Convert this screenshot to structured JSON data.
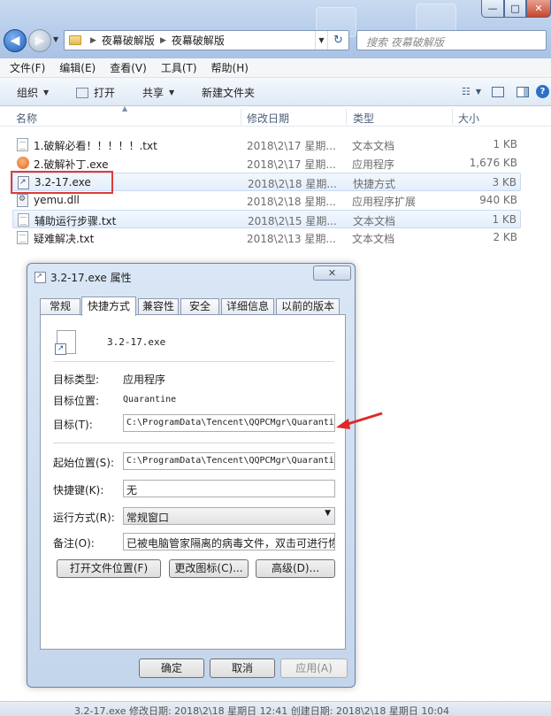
{
  "window": {
    "controls": {
      "minimize": "—",
      "maximize": "□",
      "close": "✕"
    }
  },
  "nav": {
    "back_icon": "back-arrow",
    "forward_icon": "forward-arrow",
    "breadcrumbs": [
      "夜幕破解版",
      "夜幕破解版"
    ],
    "search_placeholder": "搜索 夜幕破解版"
  },
  "menubar": {
    "items": [
      "文件(F)",
      "编辑(E)",
      "查看(V)",
      "工具(T)",
      "帮助(H)"
    ]
  },
  "commandbar": {
    "organize": "组织",
    "open": "打开",
    "share": "共享",
    "new_folder": "新建文件夹"
  },
  "columns": {
    "name": "名称",
    "date": "修改日期",
    "type": "类型",
    "size": "大小"
  },
  "files": [
    {
      "name": "1.破解必看！！！！！.txt",
      "date": "2018\\2\\17 星期...",
      "type": "文本文档",
      "size": "1 KB",
      "icon": "text-file-icon"
    },
    {
      "name": "2.破解补丁.exe",
      "date": "2018\\2\\17 星期...",
      "type": "应用程序",
      "size": "1,676 KB",
      "icon": "exe-icon"
    },
    {
      "name": "3.2-17.exe",
      "date": "2018\\2\\18 星期...",
      "type": "快捷方式",
      "size": "3 KB",
      "icon": "shortcut-icon"
    },
    {
      "name": "yemu.dll",
      "date": "2018\\2\\18 星期...",
      "type": "应用程序扩展",
      "size": "940 KB",
      "icon": "dll-icon"
    },
    {
      "name": "辅助运行步骤.txt",
      "date": "2018\\2\\15 星期...",
      "type": "文本文档",
      "size": "1 KB",
      "icon": "text-file-icon"
    },
    {
      "name": "疑难解决.txt",
      "date": "2018\\2\\13 星期...",
      "type": "文本文档",
      "size": "2 KB",
      "icon": "text-file-icon"
    }
  ],
  "dialog": {
    "title": "3.2-17.exe 属性",
    "close": "✕",
    "tabs": [
      "常规",
      "快捷方式",
      "兼容性",
      "安全",
      "详细信息",
      "以前的版本"
    ],
    "active_tab": "快捷方式",
    "shortcut_name": "3.2-17.exe",
    "target_type_label": "目标类型:",
    "target_type_value": "应用程序",
    "target_location_label": "目标位置:",
    "target_location_value": "Quarantine",
    "target_label": "目标(T):",
    "target_value": "C:\\ProgramData\\Tencent\\QQPCMgr\\Quarantine",
    "start_in_label": "起始位置(S):",
    "start_in_value": "C:\\ProgramData\\Tencent\\QQPCMgr\\Quarantine",
    "shortcut_key_label": "快捷键(K):",
    "shortcut_key_value": "无",
    "run_label": "运行方式(R):",
    "run_value": "常规窗口",
    "comment_label": "备注(O):",
    "comment_value": "已被电脑管家隔离的病毒文件，双击可进行恢复",
    "btn_open_location": "打开文件位置(F)",
    "btn_change_icon": "更改图标(C)...",
    "btn_advanced": "高级(D)...",
    "btn_ok": "确定",
    "btn_cancel": "取消",
    "btn_apply": "应用(A)"
  },
  "bottom": {
    "status": "3.2-17.exe  修改日期: 2018\\2\\18 星期日 12:41  创建日期: 2018\\2\\18 星期日 10:04"
  },
  "colors": {
    "highlight_border": "#e03a3a",
    "annotation_arrow": "#e02828",
    "selection_bg": "#e3eefb"
  }
}
